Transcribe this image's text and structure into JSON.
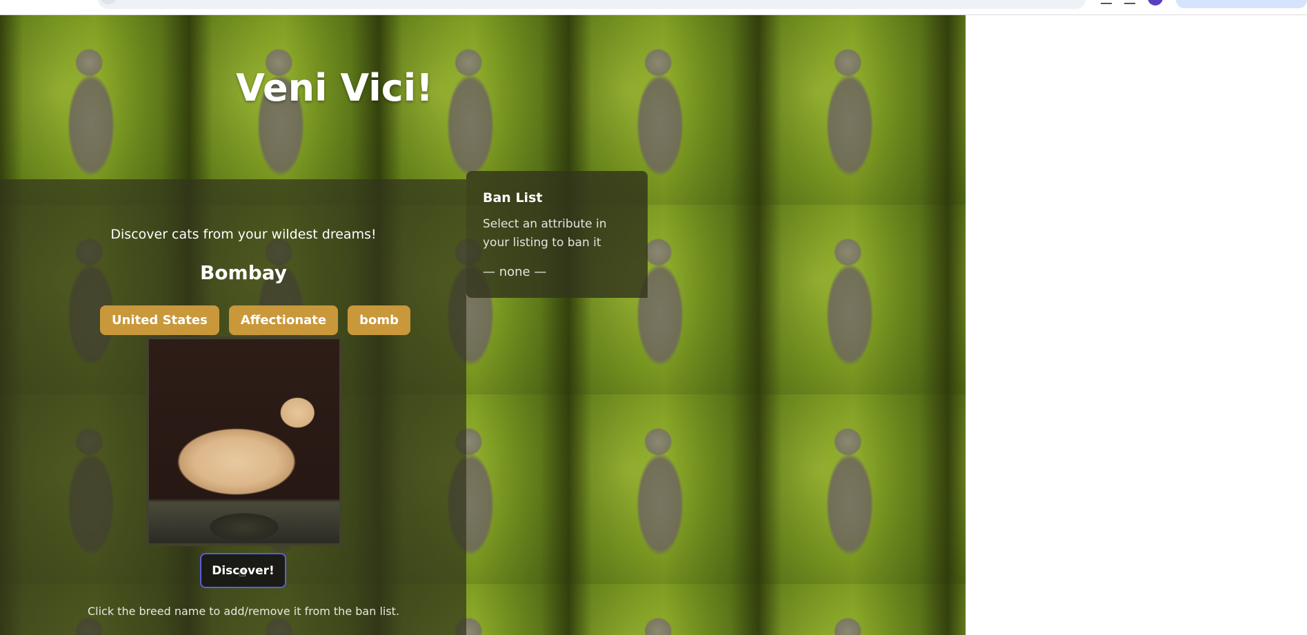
{
  "app": {
    "title": "Veni Vici!",
    "tagline": "Discover cats from your wildest dreams!"
  },
  "current_cat": {
    "breed": "Bombay",
    "attributes": [
      "United States",
      "Affectionate",
      "bomb"
    ],
    "image_alt": "Cat photo"
  },
  "actions": {
    "discover_label": "Discover!"
  },
  "helper_text": "Click the breed name to add/remove it from the ban list.",
  "ban_list": {
    "title": "Ban List",
    "help": "Select an attribute in your listing to ban it",
    "empty_text": "— none —"
  },
  "colors": {
    "attribute_button": "#c9983a",
    "panel_overlay": "#32341c",
    "discover_border": "#5a5ee0",
    "text_primary": "#ffffff"
  }
}
